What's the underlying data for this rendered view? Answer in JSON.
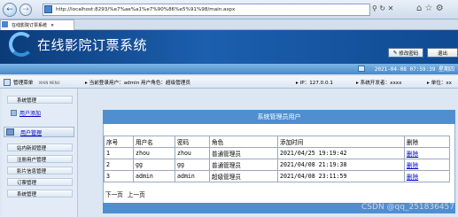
{
  "browser": {
    "url": "http://localhost:8293/%e7%ae%a1%e7%90%86%e5%91%98/main.aspx",
    "tab_title": "在线影院订票系统"
  },
  "header": {
    "title": "在线影院订票系统",
    "change_password": "修改密码",
    "logout": "退出",
    "datetime": "2021-04-08 07:59:39 星期四"
  },
  "infobar": {
    "menu_title": "管理菜单",
    "menu_title_en": "MAIN MENU",
    "current_user": "当前登录用户：admin  用户角色：超级管理员",
    "ip": "IP：127.0.0.1",
    "developer": "系统开发者：xxxx",
    "unit": "单位：xx"
  },
  "sidebar": {
    "top_item": "系统管理",
    "link_add": "用户添加",
    "group_user": "用户管理",
    "items": [
      "站内新闻管理",
      "注册用户管理",
      "影片信息管理",
      "订票管理",
      "系统管理"
    ]
  },
  "main": {
    "panel_title": "系统管理员用户",
    "columns": [
      "序号",
      "用户名",
      "密码",
      "角色",
      "添加时间",
      "删除"
    ],
    "rows": [
      {
        "id": "1",
        "username": "zhou",
        "password": "zhou",
        "role": "普通管理员",
        "added": "2021/04/25 19:19:42",
        "del": "删除"
      },
      {
        "id": "2",
        "username": "gg",
        "password": "gg",
        "role": "普通管理员",
        "added": "2021/04/08 21:19:38",
        "del": "删除"
      },
      {
        "id": "3",
        "username": "admin",
        "password": "admin",
        "role": "超级管理员",
        "added": "2021/04/08 23:11:59",
        "del": "删除"
      }
    ],
    "next_page": "下一页",
    "prev_page": "上一页"
  },
  "watermark": "CSDN @qq_251836457"
}
